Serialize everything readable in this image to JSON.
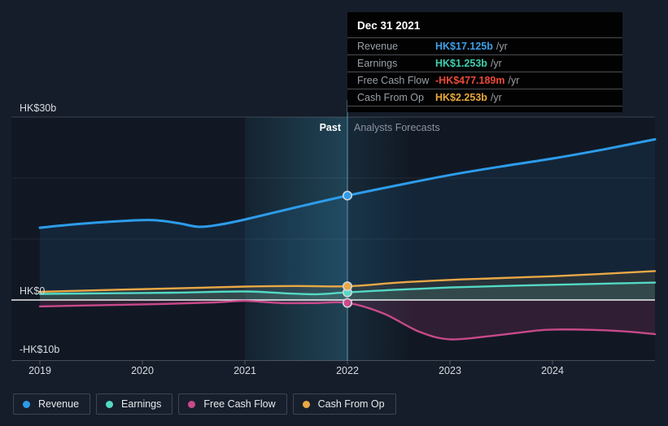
{
  "tooltip": {
    "date": "Dec 31 2021",
    "rows": [
      {
        "label": "Revenue",
        "value": "HK$17.125b",
        "suffix": "/yr",
        "color": "#3ea0e8"
      },
      {
        "label": "Earnings",
        "value": "HK$1.253b",
        "suffix": "/yr",
        "color": "#3ed0b0"
      },
      {
        "label": "Free Cash Flow",
        "value": "-HK$477.189m",
        "suffix": "/yr",
        "color": "#eb4a38"
      },
      {
        "label": "Cash From Op",
        "value": "HK$2.253b",
        "suffix": "/yr",
        "color": "#e9a93c"
      }
    ]
  },
  "chart_data": {
    "type": "line",
    "currency_unit": "HK$ billions",
    "x_domain": [
      2018.72,
      2025.0
    ],
    "ylim": [
      -10,
      30
    ],
    "grid": {
      "dim_values": [
        20,
        10
      ],
      "bright_values": [
        30
      ]
    },
    "y_labels": [
      {
        "text": "HK$30b",
        "value": 30
      },
      {
        "text": "HK$0",
        "value": 0
      },
      {
        "text": "-HK$10b",
        "value": -10
      }
    ],
    "x_ticks": [
      {
        "label": "2019",
        "x": 2019
      },
      {
        "label": "2020",
        "x": 2020
      },
      {
        "label": "2021",
        "x": 2021
      },
      {
        "label": "2022",
        "x": 2022
      },
      {
        "label": "2023",
        "x": 2023
      },
      {
        "label": "2024",
        "x": 2024
      }
    ],
    "annotations": {
      "past_label": "Past",
      "forecast_label": "Analysts Forecasts"
    },
    "past_boundary_x": 2022,
    "highlight_band": {
      "from": 2021,
      "to": 2022
    },
    "marker_x": 2022,
    "series": [
      {
        "name": "Revenue",
        "color": "#2d9cea",
        "fill": "rgba(45,156,234,0.10)",
        "marker_value": 17.125,
        "points": [
          [
            2019,
            11.85
          ],
          [
            2019.4,
            12.5
          ],
          [
            2019.8,
            12.95
          ],
          [
            2020.1,
            13.1
          ],
          [
            2020.35,
            12.6
          ],
          [
            2020.55,
            12.0
          ],
          [
            2020.75,
            12.35
          ],
          [
            2021,
            13.2
          ],
          [
            2021.5,
            15.2
          ],
          [
            2022,
            17.125
          ],
          [
            2022.5,
            18.85
          ],
          [
            2023,
            20.5
          ],
          [
            2023.5,
            21.9
          ],
          [
            2024,
            23.2
          ],
          [
            2024.5,
            24.7
          ],
          [
            2025,
            26.35
          ]
        ]
      },
      {
        "name": "Earnings",
        "color": "#53d9c4",
        "fill": "rgba(83,217,196,0.14)",
        "marker_value": 1.253,
        "points": [
          [
            2019,
            1.0
          ],
          [
            2019.6,
            1.1
          ],
          [
            2020.3,
            1.2
          ],
          [
            2021,
            1.4
          ],
          [
            2021.4,
            1.1
          ],
          [
            2021.7,
            0.95
          ],
          [
            2022,
            1.253
          ],
          [
            2022.5,
            1.7
          ],
          [
            2023,
            2.05
          ],
          [
            2023.5,
            2.3
          ],
          [
            2024,
            2.5
          ],
          [
            2024.5,
            2.68
          ],
          [
            2025,
            2.85
          ]
        ]
      },
      {
        "name": "Free Cash Flow",
        "color": "#c8498a",
        "fill": "rgba(200,73,138,0.17)",
        "marker_value": -0.477,
        "points": [
          [
            2019,
            -1.05
          ],
          [
            2019.6,
            -0.85
          ],
          [
            2020.2,
            -0.65
          ],
          [
            2020.7,
            -0.4
          ],
          [
            2021,
            -0.15
          ],
          [
            2021.35,
            -0.5
          ],
          [
            2021.7,
            -0.5
          ],
          [
            2022,
            -0.477
          ],
          [
            2022.35,
            -2.2
          ],
          [
            2022.7,
            -5.2
          ],
          [
            2023,
            -6.45
          ],
          [
            2023.4,
            -5.9
          ],
          [
            2023.8,
            -5.1
          ],
          [
            2024,
            -4.85
          ],
          [
            2024.4,
            -4.9
          ],
          [
            2024.7,
            -5.15
          ],
          [
            2025,
            -5.6
          ]
        ]
      },
      {
        "name": "Cash From Op",
        "color": "#e9a845",
        "fill": "rgba(233,168,69,0.10)",
        "marker_value": 2.253,
        "points": [
          [
            2019,
            1.35
          ],
          [
            2019.7,
            1.65
          ],
          [
            2020.4,
            1.95
          ],
          [
            2021,
            2.2
          ],
          [
            2021.5,
            2.3
          ],
          [
            2022,
            2.253
          ],
          [
            2022.5,
            2.85
          ],
          [
            2023,
            3.3
          ],
          [
            2023.5,
            3.6
          ],
          [
            2024,
            3.9
          ],
          [
            2024.5,
            4.3
          ],
          [
            2025,
            4.75
          ]
        ]
      }
    ],
    "colors": {
      "background": "#161d2a",
      "zero_line": "#ffffff",
      "highlight_band": "#3ea0be",
      "divider": "#5a8b9d"
    }
  }
}
